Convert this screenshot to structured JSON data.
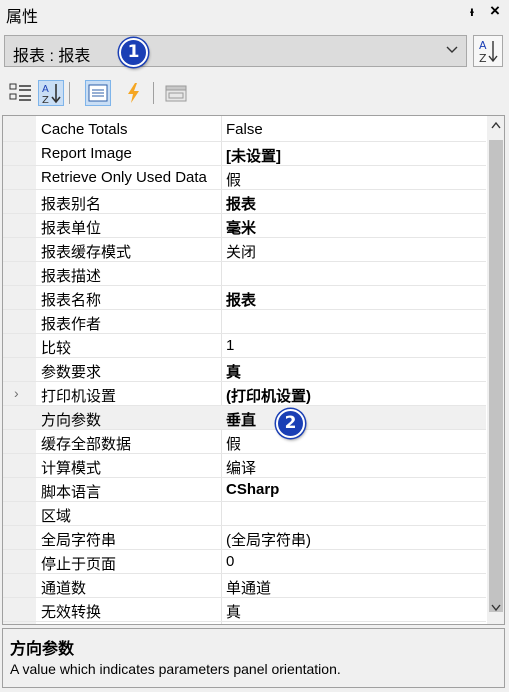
{
  "window": {
    "title": "属性",
    "pin_icon": "pin-icon",
    "close_icon": "close-icon"
  },
  "object_selector": {
    "value": "报表 : 报表",
    "badge": "1"
  },
  "toolbar": {
    "buttons": [
      "categorized-icon",
      "alphabetical-sort-icon",
      "properties-icon",
      "events-icon",
      "property-pages-icon"
    ]
  },
  "properties": [
    {
      "name": "Cache Totals",
      "value": "False",
      "bold": false
    },
    {
      "name": "Report Image",
      "value": "[未设置]",
      "bold": true
    },
    {
      "name": "Retrieve Only Used Data",
      "value": "假",
      "bold": false
    },
    {
      "name": "报表别名",
      "value": "报表",
      "bold": true
    },
    {
      "name": "报表单位",
      "value": "毫米",
      "bold": true
    },
    {
      "name": "报表缓存模式",
      "value": "关闭",
      "bold": false
    },
    {
      "name": "报表描述",
      "value": "",
      "bold": false
    },
    {
      "name": "报表名称",
      "value": "报表",
      "bold": true
    },
    {
      "name": "报表作者",
      "value": "",
      "bold": false
    },
    {
      "name": "比较",
      "value": "1",
      "bold": false
    },
    {
      "name": "参数要求",
      "value": "真",
      "bold": true
    },
    {
      "name": "打印机设置",
      "value": "(打印机设置)",
      "bold": true,
      "expandable": true
    },
    {
      "name": "方向参数",
      "value": "垂直",
      "bold": true,
      "selected": true
    },
    {
      "name": "缓存全部数据",
      "value": "假",
      "bold": false
    },
    {
      "name": "计算模式",
      "value": "编译",
      "bold": false
    },
    {
      "name": "脚本语言",
      "value": "CSharp",
      "bold": true
    },
    {
      "name": "区域",
      "value": "",
      "bold": false
    },
    {
      "name": "全局字符串",
      "value": "(全局字符串)",
      "bold": false
    },
    {
      "name": "停止于页面",
      "value": "0",
      "bold": false
    },
    {
      "name": "通道数",
      "value": "单通道",
      "bold": false
    },
    {
      "name": "无效转换",
      "value": "真",
      "bold": false
    },
    {
      "name": "",
      "value": "",
      "bold": false
    }
  ],
  "callout_badge": "2",
  "description": {
    "title": "方向参数",
    "text": "A value which indicates parameters panel orientation."
  },
  "colors": {
    "badge": "#1a3fb5",
    "active_button": "#c9def5",
    "events_icon": "#f5a623"
  }
}
